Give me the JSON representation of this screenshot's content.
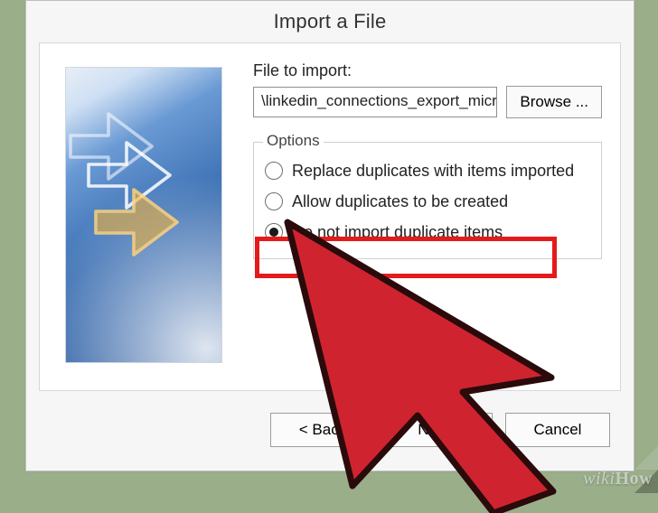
{
  "dialog": {
    "title": "Import a File",
    "file_label": "File to import:",
    "file_value": "\\linkedin_connections_export_microsoft_",
    "browse_label": "Browse ..."
  },
  "options": {
    "legend": "Options",
    "items": [
      {
        "label": "Replace duplicates with items imported",
        "selected": false
      },
      {
        "label": "Allow duplicates to be created",
        "selected": false
      },
      {
        "label": "Do not import duplicate items",
        "selected": true
      }
    ]
  },
  "buttons": {
    "back": "<  Back",
    "next": "Next  >",
    "cancel": "Cancel"
  },
  "watermark": {
    "w": "wiki",
    "how": "How"
  }
}
